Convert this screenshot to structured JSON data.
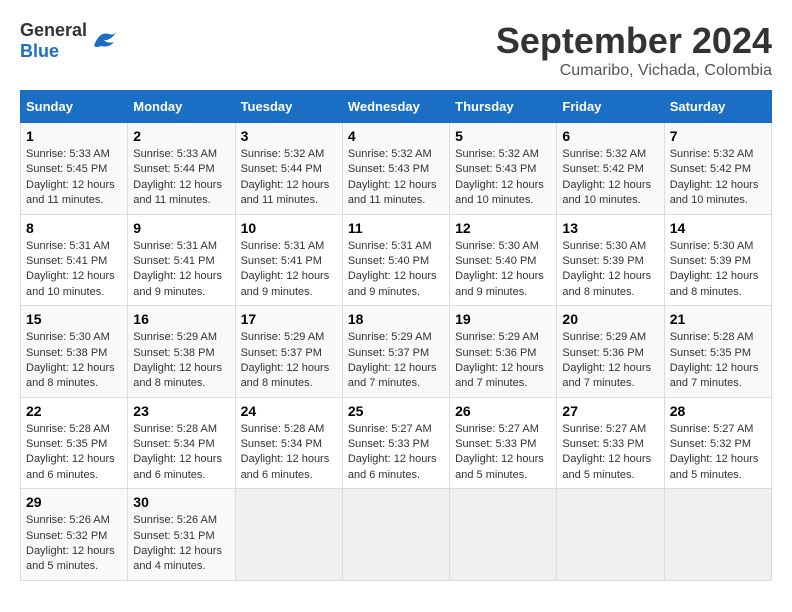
{
  "header": {
    "logo_general": "General",
    "logo_blue": "Blue",
    "month_title": "September 2024",
    "location": "Cumaribo, Vichada, Colombia"
  },
  "weekdays": [
    "Sunday",
    "Monday",
    "Tuesday",
    "Wednesday",
    "Thursday",
    "Friday",
    "Saturday"
  ],
  "weeks": [
    [
      {
        "day": "1",
        "sunrise": "Sunrise: 5:33 AM",
        "sunset": "Sunset: 5:45 PM",
        "daylight": "Daylight: 12 hours and 11 minutes."
      },
      {
        "day": "2",
        "sunrise": "Sunrise: 5:33 AM",
        "sunset": "Sunset: 5:44 PM",
        "daylight": "Daylight: 12 hours and 11 minutes."
      },
      {
        "day": "3",
        "sunrise": "Sunrise: 5:32 AM",
        "sunset": "Sunset: 5:44 PM",
        "daylight": "Daylight: 12 hours and 11 minutes."
      },
      {
        "day": "4",
        "sunrise": "Sunrise: 5:32 AM",
        "sunset": "Sunset: 5:43 PM",
        "daylight": "Daylight: 12 hours and 11 minutes."
      },
      {
        "day": "5",
        "sunrise": "Sunrise: 5:32 AM",
        "sunset": "Sunset: 5:43 PM",
        "daylight": "Daylight: 12 hours and 10 minutes."
      },
      {
        "day": "6",
        "sunrise": "Sunrise: 5:32 AM",
        "sunset": "Sunset: 5:42 PM",
        "daylight": "Daylight: 12 hours and 10 minutes."
      },
      {
        "day": "7",
        "sunrise": "Sunrise: 5:32 AM",
        "sunset": "Sunset: 5:42 PM",
        "daylight": "Daylight: 12 hours and 10 minutes."
      }
    ],
    [
      {
        "day": "8",
        "sunrise": "Sunrise: 5:31 AM",
        "sunset": "Sunset: 5:41 PM",
        "daylight": "Daylight: 12 hours and 10 minutes."
      },
      {
        "day": "9",
        "sunrise": "Sunrise: 5:31 AM",
        "sunset": "Sunset: 5:41 PM",
        "daylight": "Daylight: 12 hours and 9 minutes."
      },
      {
        "day": "10",
        "sunrise": "Sunrise: 5:31 AM",
        "sunset": "Sunset: 5:41 PM",
        "daylight": "Daylight: 12 hours and 9 minutes."
      },
      {
        "day": "11",
        "sunrise": "Sunrise: 5:31 AM",
        "sunset": "Sunset: 5:40 PM",
        "daylight": "Daylight: 12 hours and 9 minutes."
      },
      {
        "day": "12",
        "sunrise": "Sunrise: 5:30 AM",
        "sunset": "Sunset: 5:40 PM",
        "daylight": "Daylight: 12 hours and 9 minutes."
      },
      {
        "day": "13",
        "sunrise": "Sunrise: 5:30 AM",
        "sunset": "Sunset: 5:39 PM",
        "daylight": "Daylight: 12 hours and 8 minutes."
      },
      {
        "day": "14",
        "sunrise": "Sunrise: 5:30 AM",
        "sunset": "Sunset: 5:39 PM",
        "daylight": "Daylight: 12 hours and 8 minutes."
      }
    ],
    [
      {
        "day": "15",
        "sunrise": "Sunrise: 5:30 AM",
        "sunset": "Sunset: 5:38 PM",
        "daylight": "Daylight: 12 hours and 8 minutes."
      },
      {
        "day": "16",
        "sunrise": "Sunrise: 5:29 AM",
        "sunset": "Sunset: 5:38 PM",
        "daylight": "Daylight: 12 hours and 8 minutes."
      },
      {
        "day": "17",
        "sunrise": "Sunrise: 5:29 AM",
        "sunset": "Sunset: 5:37 PM",
        "daylight": "Daylight: 12 hours and 8 minutes."
      },
      {
        "day": "18",
        "sunrise": "Sunrise: 5:29 AM",
        "sunset": "Sunset: 5:37 PM",
        "daylight": "Daylight: 12 hours and 7 minutes."
      },
      {
        "day": "19",
        "sunrise": "Sunrise: 5:29 AM",
        "sunset": "Sunset: 5:36 PM",
        "daylight": "Daylight: 12 hours and 7 minutes."
      },
      {
        "day": "20",
        "sunrise": "Sunrise: 5:29 AM",
        "sunset": "Sunset: 5:36 PM",
        "daylight": "Daylight: 12 hours and 7 minutes."
      },
      {
        "day": "21",
        "sunrise": "Sunrise: 5:28 AM",
        "sunset": "Sunset: 5:35 PM",
        "daylight": "Daylight: 12 hours and 7 minutes."
      }
    ],
    [
      {
        "day": "22",
        "sunrise": "Sunrise: 5:28 AM",
        "sunset": "Sunset: 5:35 PM",
        "daylight": "Daylight: 12 hours and 6 minutes."
      },
      {
        "day": "23",
        "sunrise": "Sunrise: 5:28 AM",
        "sunset": "Sunset: 5:34 PM",
        "daylight": "Daylight: 12 hours and 6 minutes."
      },
      {
        "day": "24",
        "sunrise": "Sunrise: 5:28 AM",
        "sunset": "Sunset: 5:34 PM",
        "daylight": "Daylight: 12 hours and 6 minutes."
      },
      {
        "day": "25",
        "sunrise": "Sunrise: 5:27 AM",
        "sunset": "Sunset: 5:33 PM",
        "daylight": "Daylight: 12 hours and 6 minutes."
      },
      {
        "day": "26",
        "sunrise": "Sunrise: 5:27 AM",
        "sunset": "Sunset: 5:33 PM",
        "daylight": "Daylight: 12 hours and 5 minutes."
      },
      {
        "day": "27",
        "sunrise": "Sunrise: 5:27 AM",
        "sunset": "Sunset: 5:33 PM",
        "daylight": "Daylight: 12 hours and 5 minutes."
      },
      {
        "day": "28",
        "sunrise": "Sunrise: 5:27 AM",
        "sunset": "Sunset: 5:32 PM",
        "daylight": "Daylight: 12 hours and 5 minutes."
      }
    ],
    [
      {
        "day": "29",
        "sunrise": "Sunrise: 5:26 AM",
        "sunset": "Sunset: 5:32 PM",
        "daylight": "Daylight: 12 hours and 5 minutes."
      },
      {
        "day": "30",
        "sunrise": "Sunrise: 5:26 AM",
        "sunset": "Sunset: 5:31 PM",
        "daylight": "Daylight: 12 hours and 4 minutes."
      },
      null,
      null,
      null,
      null,
      null
    ]
  ]
}
